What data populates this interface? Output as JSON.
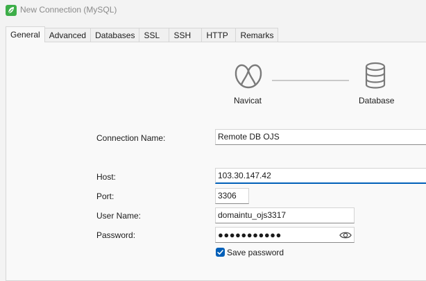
{
  "window": {
    "title": "New Connection (MySQL)",
    "app_icon": "navicat-leaf-icon",
    "accent": "#005fb8"
  },
  "tabs": [
    {
      "label": "General",
      "active": true
    },
    {
      "label": "Advanced"
    },
    {
      "label": "Databases"
    },
    {
      "label": "SSL"
    },
    {
      "label": "SSH"
    },
    {
      "label": "HTTP"
    },
    {
      "label": "Remarks"
    }
  ],
  "diagram": {
    "left_label": "Navicat",
    "left_icon": "navicat-logo-icon",
    "right_label": "Database",
    "right_icon": "database-icon"
  },
  "form": {
    "connection_name_label": "Connection Name:",
    "connection_name_value": "Remote DB OJS",
    "host_label": "Host:",
    "host_value": "103.30.147.42",
    "port_label": "Port:",
    "port_value": "3306",
    "username_label": "User Name:",
    "username_value": "domaintu_ojs3317",
    "password_label": "Password:",
    "password_masked": "●●●●●●●●●●●",
    "password_toggle_icon": "eye-icon",
    "save_password_label": "Save password",
    "save_password_checked": true
  }
}
